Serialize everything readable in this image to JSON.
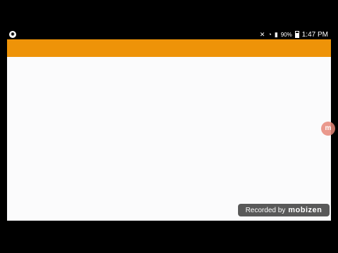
{
  "status_bar": {
    "battery_percent": "90%",
    "time": "1:47 PM",
    "icons": [
      "app-notification-icon",
      "mute-icon",
      "wifi-icon",
      "signal-icon",
      "battery-icon"
    ]
  },
  "app_bar": {
    "color": "#ee9308"
  },
  "floating_bubble": {
    "label": "m"
  },
  "watermark": {
    "prefix": "Recorded by",
    "brand": "mobizen"
  }
}
